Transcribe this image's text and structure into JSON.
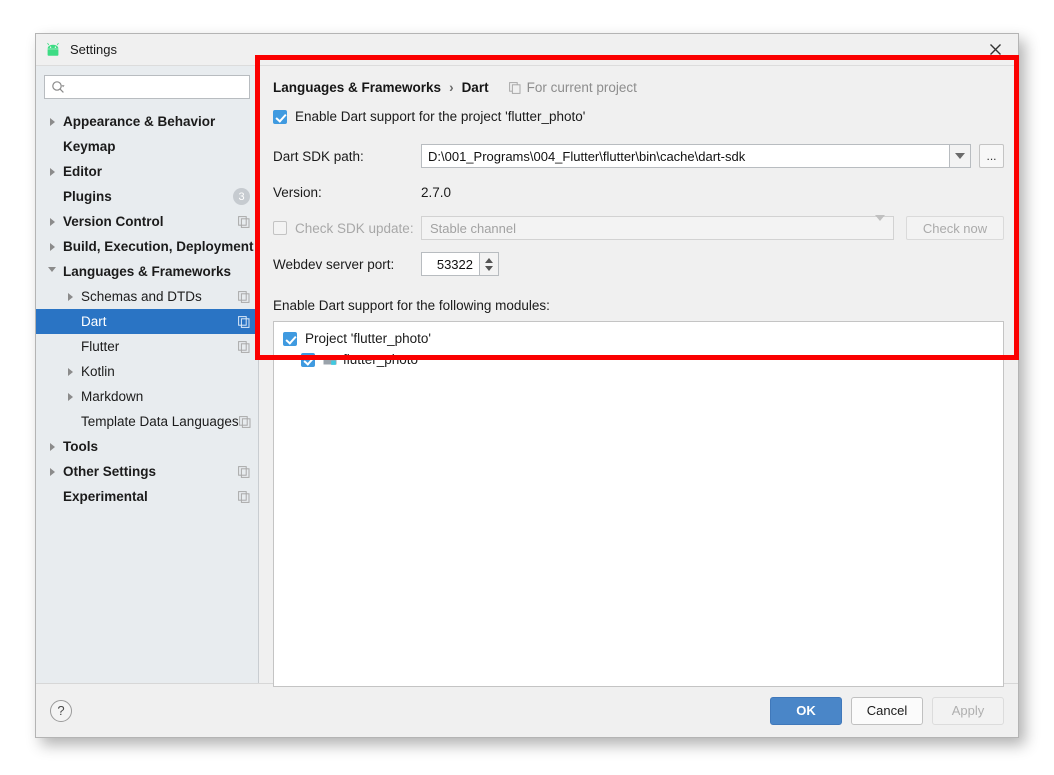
{
  "window": {
    "title": "Settings",
    "app_icon": "android-robot-icon",
    "close_icon": "close-icon"
  },
  "sidebar": {
    "search": {
      "placeholder": "",
      "value": "",
      "icon": "search-icon"
    },
    "items": [
      {
        "label": "Appearance & Behavior",
        "level": 0,
        "bold": true,
        "arrow": "right",
        "selected": false
      },
      {
        "label": "Keymap",
        "level": 0,
        "bold": true,
        "arrow": "none",
        "selected": false
      },
      {
        "label": "Editor",
        "level": 0,
        "bold": true,
        "arrow": "right",
        "selected": false
      },
      {
        "label": "Plugins",
        "level": 0,
        "bold": true,
        "arrow": "none",
        "selected": false,
        "badge": "3"
      },
      {
        "label": "Version Control",
        "level": 0,
        "bold": true,
        "arrow": "right",
        "selected": false,
        "copy": true
      },
      {
        "label": "Build, Execution, Deployment",
        "level": 0,
        "bold": true,
        "arrow": "right",
        "selected": false
      },
      {
        "label": "Languages & Frameworks",
        "level": 0,
        "bold": true,
        "arrow": "down",
        "selected": false
      },
      {
        "label": "Schemas and DTDs",
        "level": 1,
        "bold": false,
        "arrow": "right",
        "selected": false,
        "copy": true
      },
      {
        "label": "Dart",
        "level": 1,
        "bold": false,
        "arrow": "none",
        "selected": true,
        "copy": true
      },
      {
        "label": "Flutter",
        "level": 1,
        "bold": false,
        "arrow": "none",
        "selected": false,
        "copy": true
      },
      {
        "label": "Kotlin",
        "level": 1,
        "bold": false,
        "arrow": "right",
        "selected": false
      },
      {
        "label": "Markdown",
        "level": 1,
        "bold": false,
        "arrow": "right",
        "selected": false
      },
      {
        "label": "Template Data Languages",
        "level": 1,
        "bold": false,
        "arrow": "none",
        "selected": false,
        "copy": true
      },
      {
        "label": "Tools",
        "level": 0,
        "bold": true,
        "arrow": "right",
        "selected": false
      },
      {
        "label": "Other Settings",
        "level": 0,
        "bold": true,
        "arrow": "right",
        "selected": false,
        "copy": true
      },
      {
        "label": "Experimental",
        "level": 0,
        "bold": true,
        "arrow": "none",
        "selected": false,
        "copy": true
      }
    ]
  },
  "main": {
    "breadcrumb": {
      "parent": "Languages & Frameworks",
      "separator": "›",
      "current": "Dart",
      "scope_label": "For current project",
      "scope_icon": "copy-icon"
    },
    "enable_support": {
      "label": "Enable Dart support for the project 'flutter_photo'",
      "checked": true
    },
    "sdk_path": {
      "label": "Dart SDK path:",
      "value": "D:\\001_Programs\\004_Flutter\\flutter\\bin\\cache\\dart-sdk",
      "browse_label": "...",
      "dropdown_icon": "chevron-down-icon"
    },
    "version": {
      "label": "Version:",
      "value": "2.7.0"
    },
    "check_update": {
      "label": "Check SDK update:",
      "checked": false,
      "enabled": false,
      "channel_value": "Stable channel",
      "button_label": "Check now"
    },
    "webdev_port": {
      "label": "Webdev server port:",
      "value": "53322"
    },
    "modules": {
      "label": "Enable Dart support for the following modules:",
      "rows": [
        {
          "label": "Project 'flutter_photo'",
          "level": 0,
          "checked": true,
          "icon": null
        },
        {
          "label": "flutter_photo",
          "level": 1,
          "checked": true,
          "icon": "module-icon"
        }
      ]
    }
  },
  "footer": {
    "help_label": "?",
    "ok_label": "OK",
    "cancel_label": "Cancel",
    "apply_label": "Apply"
  },
  "annotation": {
    "color": "#fb0000",
    "shape": "rectangle"
  }
}
